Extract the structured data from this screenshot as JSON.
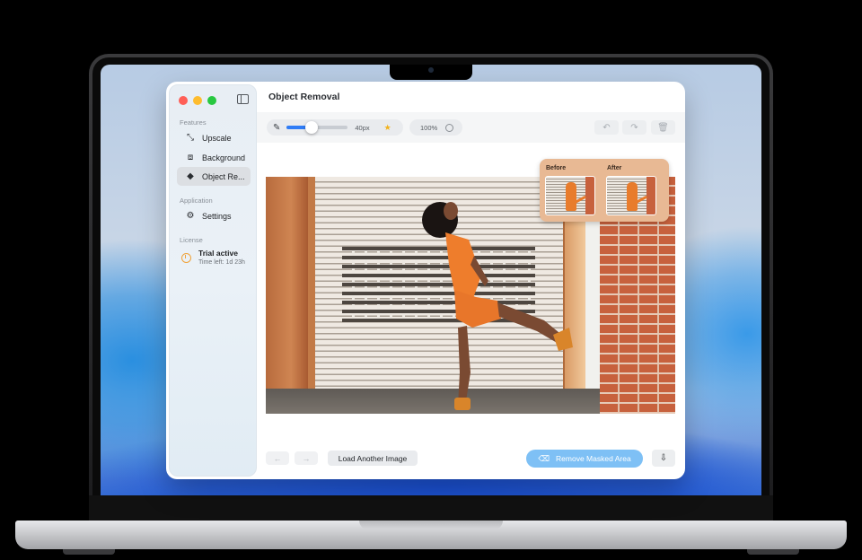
{
  "window": {
    "title": "Object Removal"
  },
  "sidebar": {
    "sections": [
      {
        "label": "Features"
      },
      {
        "label": "Application"
      },
      {
        "label": "License"
      }
    ],
    "items": [
      {
        "label": "Upscale",
        "icon": "arrows-expand-icon"
      },
      {
        "label": "Background",
        "icon": "person-frame-icon"
      },
      {
        "label": "Object Re...",
        "icon": "eraser-icon",
        "active": true
      },
      {
        "label": "Settings",
        "icon": "gear-icon"
      }
    ],
    "license": {
      "status": "Trial active",
      "time_left": "Time left: 1d 23h"
    }
  },
  "toolbar": {
    "brush_size": "40px",
    "brush_slider_fraction": 0.4,
    "zoom": "100%",
    "buttons": [
      "undo-icon",
      "redo-icon",
      "trash-icon"
    ]
  },
  "preview": {
    "before_label": "Before",
    "after_label": "After"
  },
  "bottom": {
    "load_label": "Load Another Image",
    "remove_label": "Remove Masked Area"
  },
  "colors": {
    "accent": "#2f7cf6",
    "remove_button": "#7ec0f5",
    "star": "#f2b21b",
    "license_icon": "#f0a33a"
  }
}
